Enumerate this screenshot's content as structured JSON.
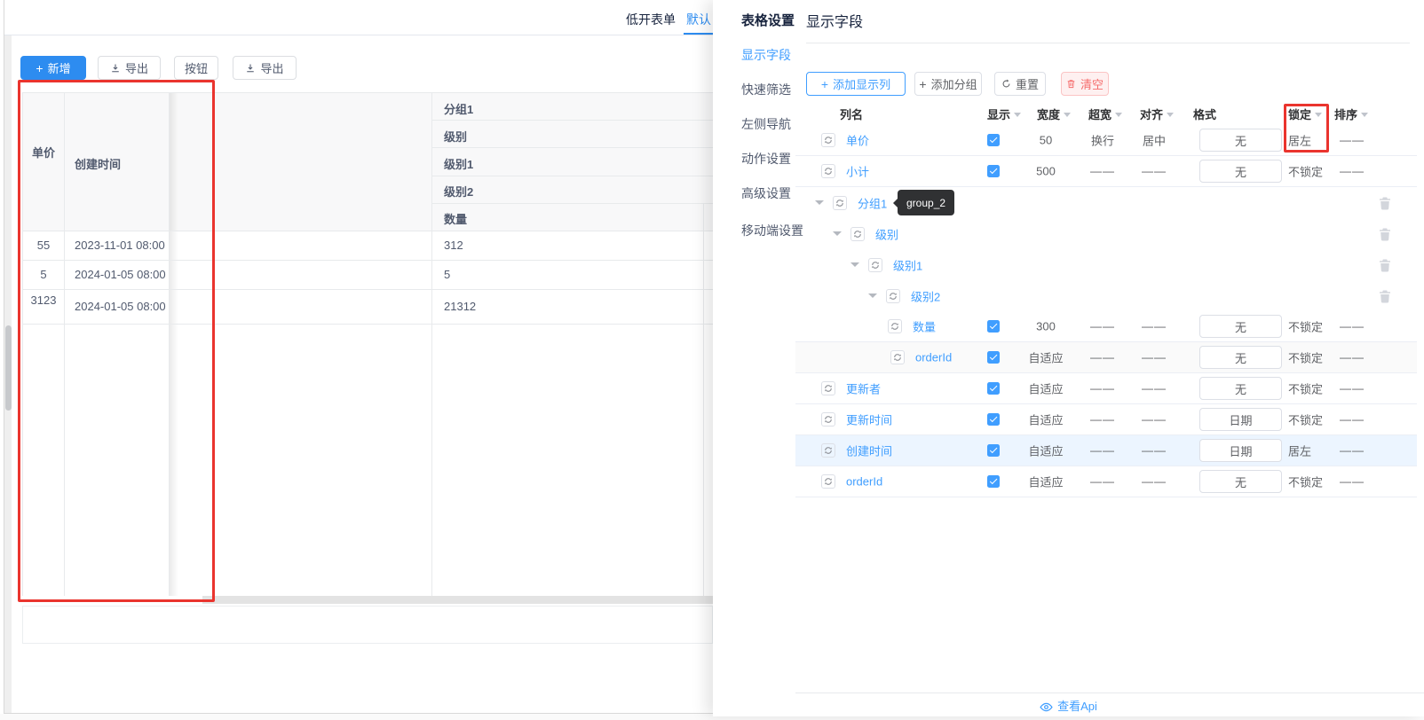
{
  "colors": {
    "primary_left": "#2d8cf0",
    "primary_right": "#409eff",
    "annotation_red": "#ea342e",
    "danger": "#f56c6c"
  },
  "tabs": [
    {
      "label": "低开表单"
    },
    {
      "label": "默认"
    }
  ],
  "toolbar": {
    "add_label": "新增",
    "export_label": "导出",
    "button_label": "按钮",
    "export2_label": "导出"
  },
  "main_table": {
    "fixed_headers": [
      "单价",
      "创建时间"
    ],
    "group_headers": [
      "分组1",
      "级别",
      "级别1",
      "级别2",
      "数量"
    ],
    "rows": [
      {
        "price": "55",
        "created": "2023-11-01 08:00",
        "qty": "312"
      },
      {
        "price": "5",
        "created": "2024-01-05 08:00",
        "qty": "5"
      },
      {
        "price": "3123",
        "created": "2024-01-05 08:00",
        "qty": "21312"
      }
    ]
  },
  "drawer": {
    "sidebar": {
      "title": "表格设置",
      "items": [
        {
          "label": "显示字段",
          "active": true
        },
        {
          "label": "快速筛选",
          "active": false
        },
        {
          "label": "左侧导航",
          "active": false
        },
        {
          "label": "动作设置",
          "active": false
        },
        {
          "label": "高级设置",
          "active": false
        },
        {
          "label": "移动端设置",
          "active": false
        }
      ]
    },
    "title": "显示字段",
    "buttons": {
      "add_column": "添加显示列",
      "add_group": "添加分组",
      "reset": "重置",
      "clear": "清空"
    },
    "table": {
      "headers": [
        "列名",
        "显示",
        "宽度",
        "超宽",
        "对齐",
        "格式",
        "锁定",
        "排序"
      ]
    },
    "rows": [
      {
        "name": "单价",
        "width": "50",
        "wrap": "换行",
        "align": "居中",
        "format": "无",
        "lock": "居左",
        "sort": "——"
      },
      {
        "name": "小计",
        "width": "500",
        "wrap": "——",
        "align": "——",
        "format": "无",
        "lock": "不锁定",
        "sort": "——"
      },
      {
        "name": "分组1",
        "tooltip": "group_2"
      },
      {
        "name": "级别"
      },
      {
        "name": "级别1"
      },
      {
        "name": "级别2"
      },
      {
        "name": "数量",
        "width": "300",
        "wrap": "——",
        "align": "——",
        "format": "无",
        "lock": "不锁定",
        "sort": "——"
      },
      {
        "name": "orderId",
        "width": "自适应",
        "wrap": "——",
        "align": "——",
        "format": "无",
        "lock": "不锁定",
        "sort": "——"
      },
      {
        "name": "更新者",
        "width": "自适应",
        "wrap": "——",
        "align": "——",
        "format": "无",
        "lock": "不锁定",
        "sort": "——"
      },
      {
        "name": "更新时间",
        "width": "自适应",
        "wrap": "——",
        "align": "——",
        "format": "日期",
        "lock": "不锁定",
        "sort": "——"
      },
      {
        "name": "创建时间",
        "width": "自适应",
        "wrap": "——",
        "align": "——",
        "format": "日期",
        "lock": "居左",
        "sort": "——"
      },
      {
        "name": "orderId",
        "width": "自适应",
        "wrap": "——",
        "align": "——",
        "format": "无",
        "lock": "不锁定",
        "sort": "——"
      }
    ],
    "footer": {
      "api_link": "查看Api"
    }
  }
}
